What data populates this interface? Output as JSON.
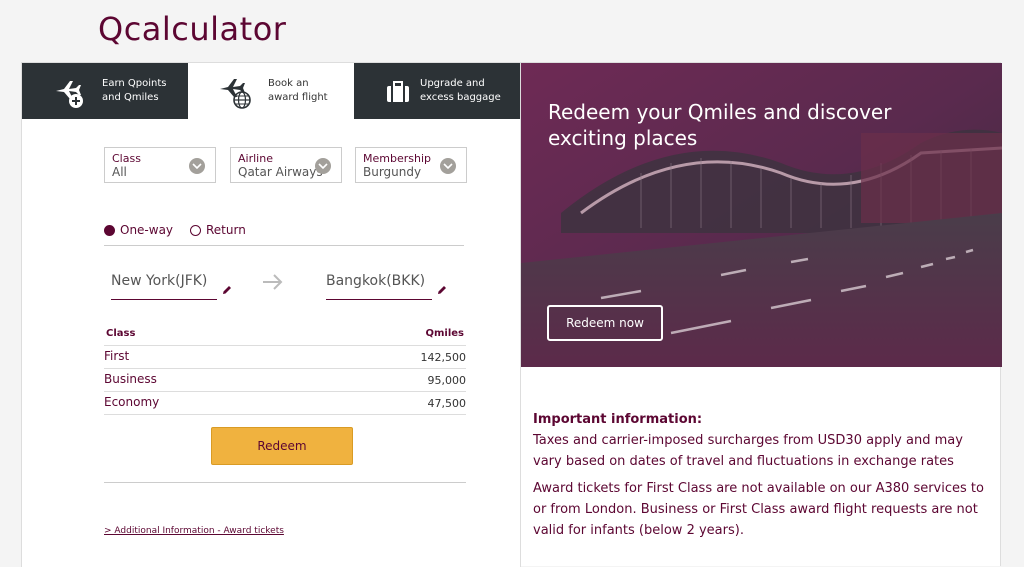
{
  "page": {
    "title": "Qcalculator"
  },
  "tabs": [
    {
      "label_line1": "Earn Qpoints",
      "label_line2": "and Qmiles",
      "icon": "plane-plus-icon"
    },
    {
      "label_line1": "Book an",
      "label_line2": "award flight",
      "icon": "plane-globe-icon"
    },
    {
      "label_line1": "Upgrade and",
      "label_line2": "excess baggage",
      "icon": "suitcase-icon"
    }
  ],
  "filters": {
    "class": {
      "label": "Class",
      "value": "All"
    },
    "airline": {
      "label": "Airline",
      "value": "Qatar Airways"
    },
    "membership": {
      "label": "Membership",
      "value": "Burgundy"
    }
  },
  "trip_type": {
    "one_way": "One-way",
    "return": "Return",
    "selected": "One-way"
  },
  "route": {
    "from": "New York(JFK)",
    "to": "Bangkok(BKK)"
  },
  "miles_table": {
    "headers": [
      "Class",
      "Qmiles"
    ],
    "rows": [
      {
        "cls": "First",
        "miles": "142,500"
      },
      {
        "cls": "Business",
        "miles": "95,000"
      },
      {
        "cls": "Economy",
        "miles": "47,500"
      }
    ]
  },
  "actions": {
    "redeem": "Redeem",
    "info_link": "> Additional Information - Award tickets"
  },
  "hero": {
    "title": "Redeem your Qmiles and discover exciting places",
    "button": "Redeem now"
  },
  "info": {
    "heading": "Important information:",
    "p1": "Taxes and carrier-imposed surcharges from USD30 apply and may vary based on dates of travel and fluctuations in exchange rates",
    "p2": "Award tickets for First Class are not available on our A380 services to or from London. Business or First Class award flight requests are not valid for infants (below 2 years)."
  },
  "colors": {
    "brand": "#5c0632",
    "accent": "#f0b23f",
    "tab_dark": "#2c3236"
  }
}
